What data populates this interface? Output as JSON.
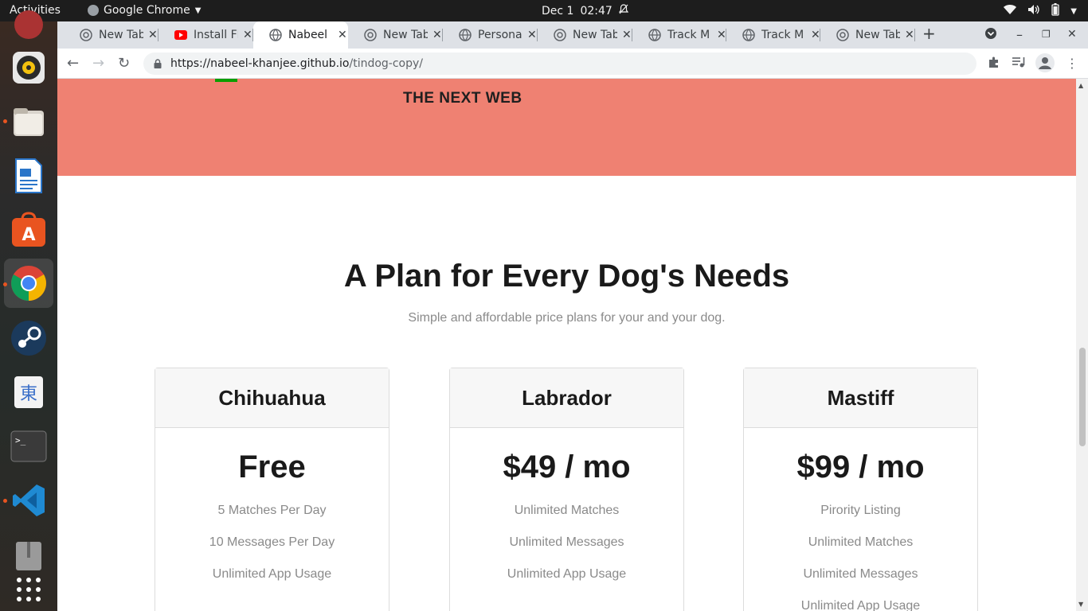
{
  "topbar": {
    "activities": "Activities",
    "app_name": "Google Chrome",
    "date": "Dec 1",
    "time": "02:47"
  },
  "dock": {
    "items": [
      "rhythmbox-icon",
      "files-icon",
      "writer-icon",
      "software-icon",
      "chrome-icon",
      "steam-icon",
      "ibus-icon",
      "terminal-icon",
      "vscode-icon",
      "archive-icon",
      "apps-grid-icon"
    ]
  },
  "tabs": [
    {
      "title": "New Tab",
      "icon": "chrome-icon"
    },
    {
      "title": "Install Fl",
      "icon": "youtube-icon"
    },
    {
      "title": "Nabeel",
      "icon": "globe-icon",
      "active": true
    },
    {
      "title": "New Tab",
      "icon": "chrome-icon"
    },
    {
      "title": "Personal",
      "icon": "globe-icon"
    },
    {
      "title": "New Tab",
      "icon": "chrome-icon"
    },
    {
      "title": "Track M",
      "icon": "globe-icon"
    },
    {
      "title": "Track M",
      "icon": "globe-icon"
    },
    {
      "title": "New Tab",
      "icon": "chrome-icon"
    }
  ],
  "omnibox": {
    "host": "https://nabeel-khanjee.github.io",
    "path": "/tindog-copy/"
  },
  "press": {
    "tnw": "THE NEXT WEB"
  },
  "pricing": {
    "heading": "A Plan for Every Dog's Needs",
    "subheading": "Simple and affordable price plans for your and your dog.",
    "plans": [
      {
        "name": "Chihuahua",
        "price": "Free",
        "features": [
          "5 Matches Per Day",
          "10 Messages Per Day",
          "Unlimited App Usage"
        ]
      },
      {
        "name": "Labrador",
        "price": "$49 / mo",
        "features": [
          "Unlimited Matches",
          "Unlimited Messages",
          "Unlimited App Usage"
        ]
      },
      {
        "name": "Mastiff",
        "price": "$99 / mo",
        "features": [
          "Pirority Listing",
          "Unlimited Matches",
          "Unlimited Messages",
          "Unlimited App Usage"
        ]
      }
    ]
  },
  "colors": {
    "press_bg": "#ef8172",
    "topbar_bg": "#1d1d1d",
    "tabstrip_bg": "#dee1e6"
  }
}
